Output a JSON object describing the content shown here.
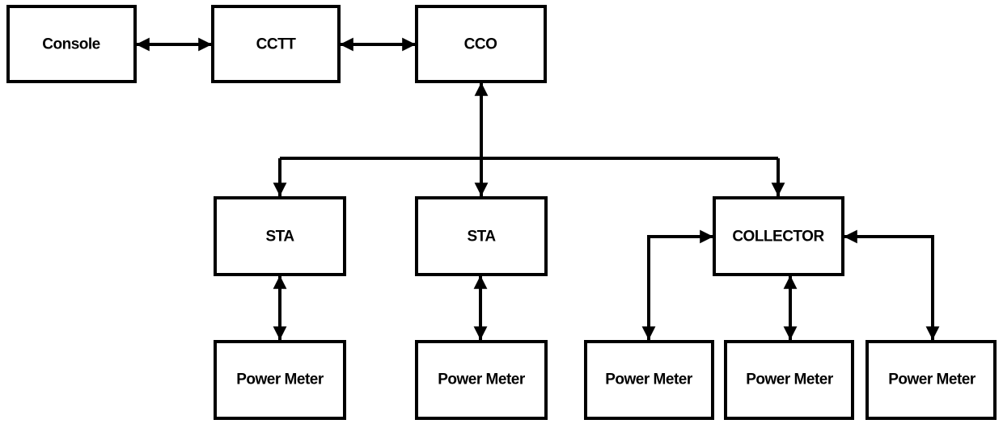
{
  "diagram": {
    "type": "block-diagram",
    "colors": {
      "stroke": "#000000",
      "fill": "#ffffff",
      "text": "#000000"
    },
    "nodes": [
      {
        "id": "console",
        "label": "Console"
      },
      {
        "id": "cctt",
        "label": "CCTT"
      },
      {
        "id": "cco",
        "label": "CCO"
      },
      {
        "id": "sta1",
        "label": "STA"
      },
      {
        "id": "sta2",
        "label": "STA"
      },
      {
        "id": "collector",
        "label": "COLLECTOR"
      },
      {
        "id": "pm1",
        "label": "Power Meter"
      },
      {
        "id": "pm2",
        "label": "Power Meter"
      },
      {
        "id": "pm3",
        "label": "Power Meter"
      },
      {
        "id": "pm4",
        "label": "Power Meter"
      },
      {
        "id": "pm5",
        "label": "Power Meter"
      }
    ],
    "edges": [
      {
        "from": "console",
        "to": "cctt",
        "direction": "bidirectional"
      },
      {
        "from": "cctt",
        "to": "cco",
        "direction": "bidirectional"
      },
      {
        "from": "cco",
        "to": "bus",
        "direction": "bidirectional"
      },
      {
        "from": "bus",
        "to": "sta1",
        "direction": "forward"
      },
      {
        "from": "bus",
        "to": "sta2",
        "direction": "forward"
      },
      {
        "from": "bus",
        "to": "collector",
        "direction": "forward"
      },
      {
        "from": "sta1",
        "to": "pm1",
        "direction": "bidirectional"
      },
      {
        "from": "sta2",
        "to": "pm2",
        "direction": "bidirectional"
      },
      {
        "from": "collector",
        "to": "pm3",
        "direction": "bidirectional"
      },
      {
        "from": "collector",
        "to": "pm4",
        "direction": "bidirectional"
      },
      {
        "from": "collector",
        "to": "pm5",
        "direction": "bidirectional"
      }
    ]
  }
}
